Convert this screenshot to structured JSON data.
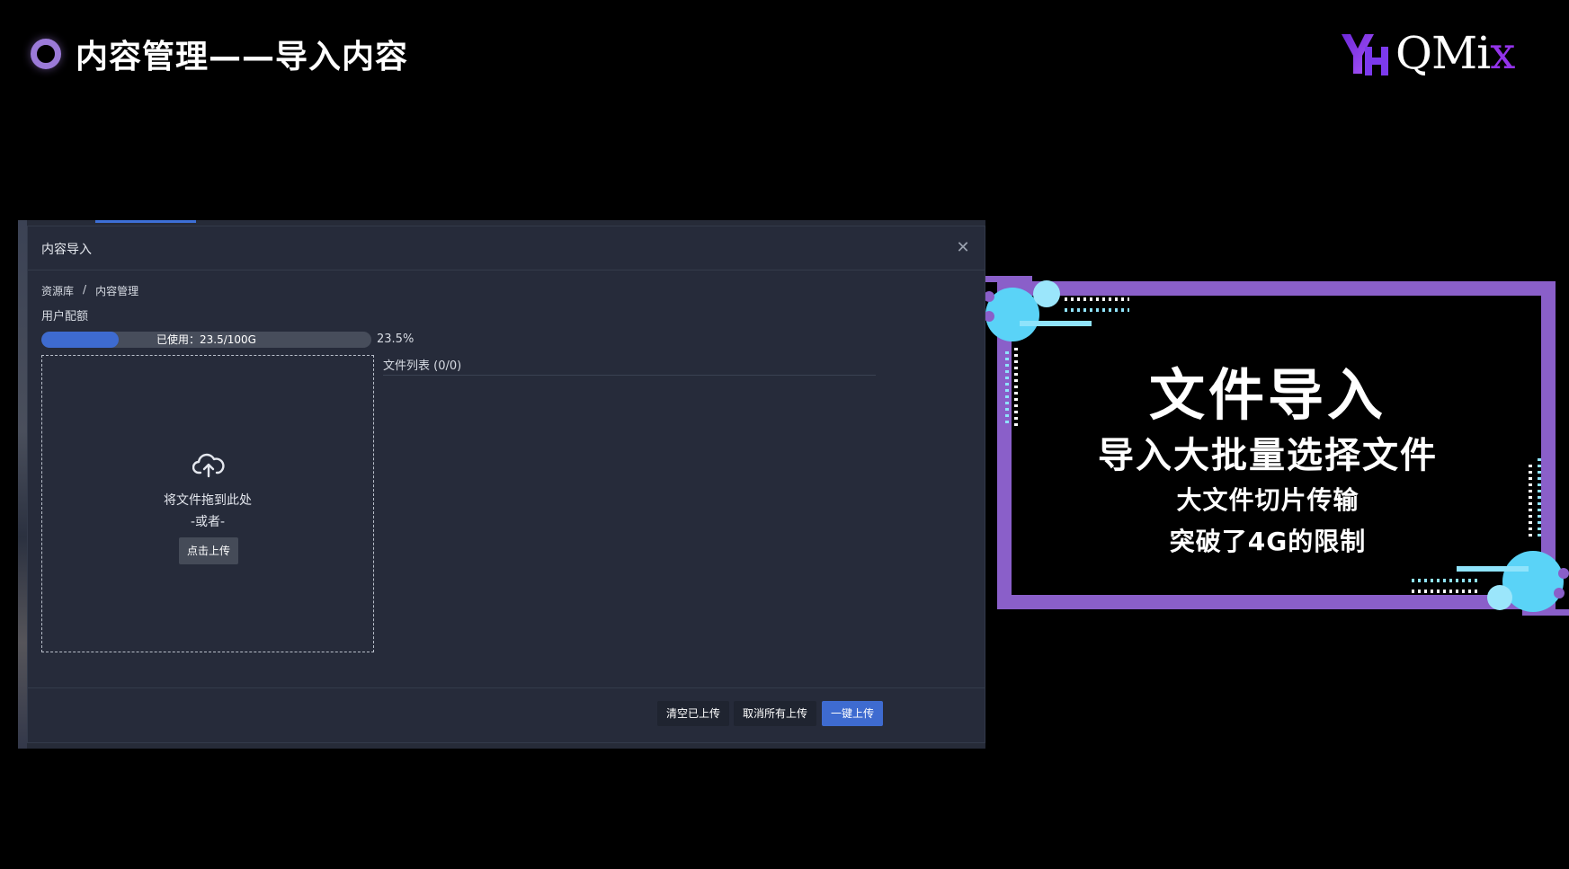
{
  "slide": {
    "title": "内容管理——导入内容",
    "logo_text": "QMi",
    "logo_x": "x",
    "logo_mark": "YH"
  },
  "dialog": {
    "title": "内容导入",
    "breadcrumb": [
      "资源库",
      "/",
      "内容管理"
    ],
    "quota_label": "用户配额",
    "usage_text": "已使用：23.5/100G",
    "usage_percent_text": "23.5%",
    "usage_fraction": 0.235,
    "dropzone": {
      "hint": "将文件拖到此处",
      "or": "-或者-",
      "button": "点击上传"
    },
    "file_list_title": "文件列表 (0/0)",
    "footer": {
      "clear": "清空已上传",
      "cancel_all": "取消所有上传",
      "upload_all": "一键上传"
    }
  },
  "promo": {
    "line1": "文件导入",
    "line2": "导入大批量选择文件",
    "line3": "大文件切片传输",
    "line4": "突破了4G的限制"
  },
  "colors": {
    "accent_purple": "#8a5fc9",
    "accent_cyan": "#5ad3f7",
    "primary_blue": "#3e6bd0"
  },
  "icons": [
    "close-icon",
    "cloud-upload-icon"
  ]
}
